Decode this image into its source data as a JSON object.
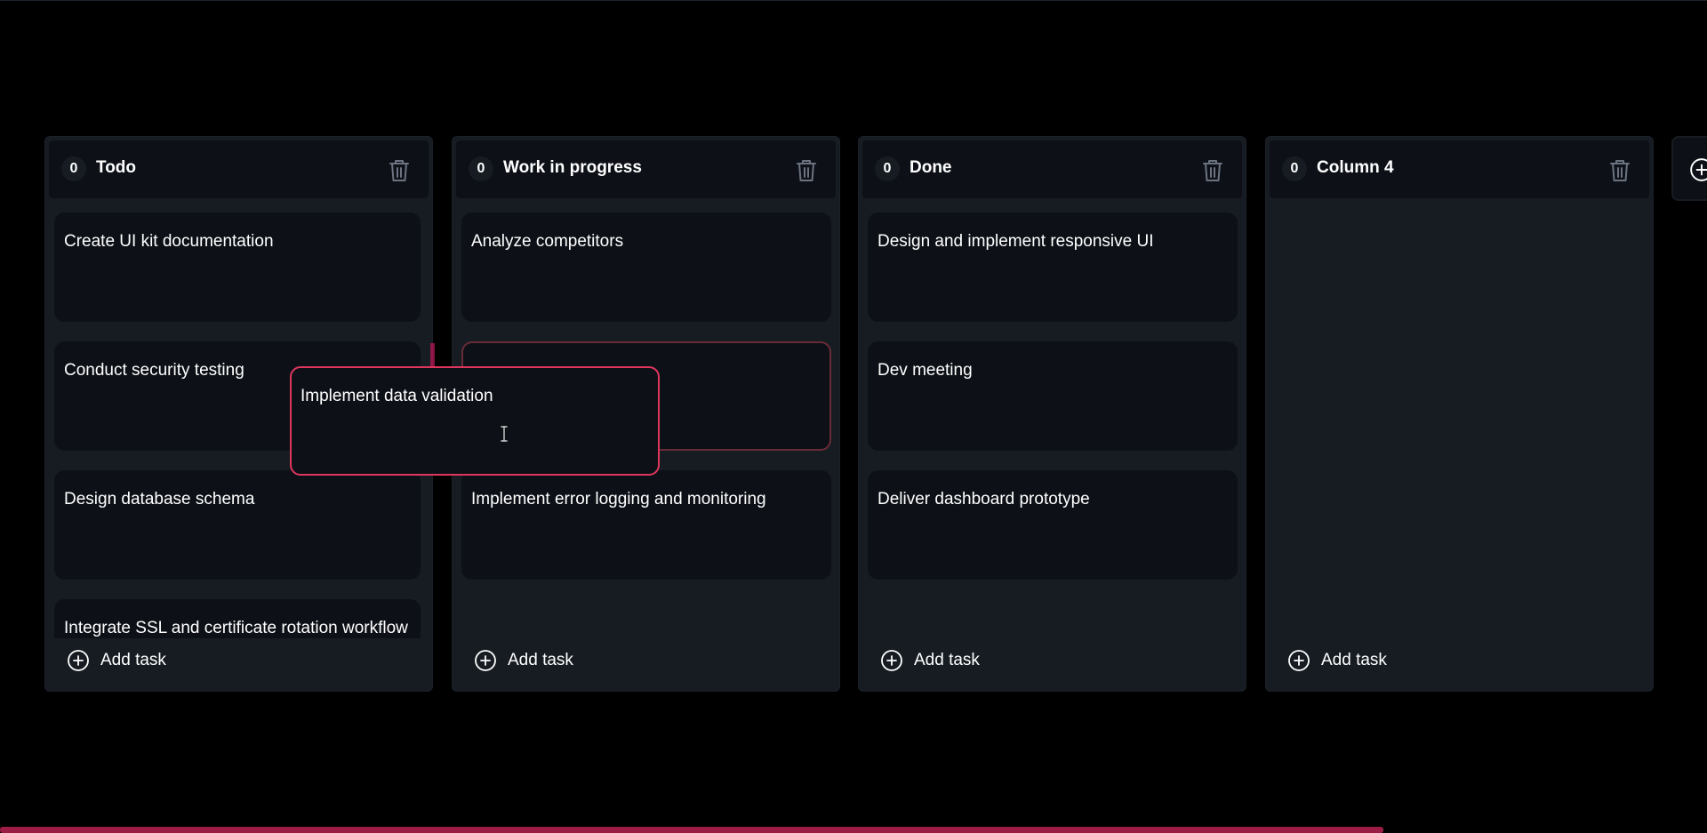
{
  "columns": [
    {
      "count": "0",
      "title": "Todo",
      "tasks": [
        "Create UI kit documentation",
        "Conduct security testing",
        "Design database schema",
        "Integrate SSL and certificate rotation workflow"
      ]
    },
    {
      "count": "0",
      "title": "Work in progress",
      "tasks": [
        "Analyze competitors",
        "",
        "Implement error logging and monitoring"
      ]
    },
    {
      "count": "0",
      "title": "Done",
      "tasks": [
        "Design and implement responsive UI",
        "Dev meeting",
        "Deliver dashboard prototype"
      ]
    },
    {
      "count": "0",
      "title": "Column 4",
      "tasks": []
    }
  ],
  "add_task_label": "Add task",
  "dragging_task": "Implement data validation",
  "icons": {
    "delete": "trash-icon",
    "add_task": "plus-circle-icon",
    "add_column": "plus-circle-icon"
  },
  "colors": {
    "background": "#000000",
    "column_bg": "#161c22",
    "card_bg": "#0d1117",
    "accent": "#e0365e",
    "scrollbar": "#9b1d45"
  }
}
